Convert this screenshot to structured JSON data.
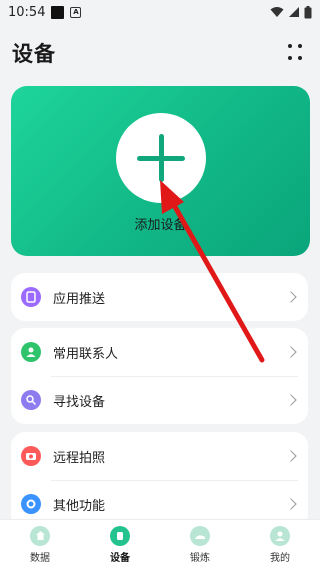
{
  "status": {
    "time": "10:54",
    "a_badge": "A"
  },
  "header": {
    "title": "设备"
  },
  "device_card": {
    "add_label": "添加设备"
  },
  "groups": [
    [
      {
        "label": "应用推送",
        "icon": "app-push-icon",
        "color": "#9b6bff"
      }
    ],
    [
      {
        "label": "常用联系人",
        "icon": "contact-icon",
        "color": "#2fc36b"
      },
      {
        "label": "寻找设备",
        "icon": "find-device-icon",
        "color": "#8c7cf0"
      }
    ],
    [
      {
        "label": "远程拍照",
        "icon": "remote-camera-icon",
        "color": "#ff5a5a"
      },
      {
        "label": "其他功能",
        "icon": "other-functions-icon",
        "color": "#3a93ff"
      }
    ]
  ],
  "tabs": [
    {
      "label": "数据",
      "icon": "home-icon",
      "active": false
    },
    {
      "label": "设备",
      "icon": "device-icon",
      "active": true
    },
    {
      "label": "锻炼",
      "icon": "exercise-icon",
      "active": false
    },
    {
      "label": "我的",
      "icon": "profile-icon",
      "active": false
    }
  ],
  "colors": {
    "accent": "#12b887",
    "annotation_arrow": "#e01818"
  }
}
